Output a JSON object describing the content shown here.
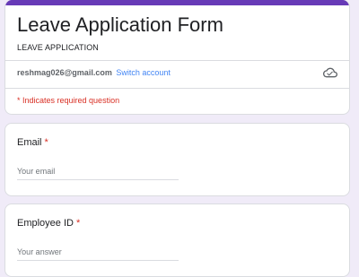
{
  "header": {
    "accent_color": "#673ab7",
    "title": "Leave Application Form",
    "description": "LEAVE APPLICATION",
    "account_email": "reshmag026@gmail.com",
    "switch_account_label": "Switch account",
    "cloud_icon": "cloud-saved-icon",
    "required_note": "* Indicates required question"
  },
  "questions": [
    {
      "label": "Email",
      "required_mark": "*",
      "placeholder": "Your email"
    },
    {
      "label": "Employee ID",
      "required_mark": "*",
      "placeholder": "Your answer"
    }
  ]
}
